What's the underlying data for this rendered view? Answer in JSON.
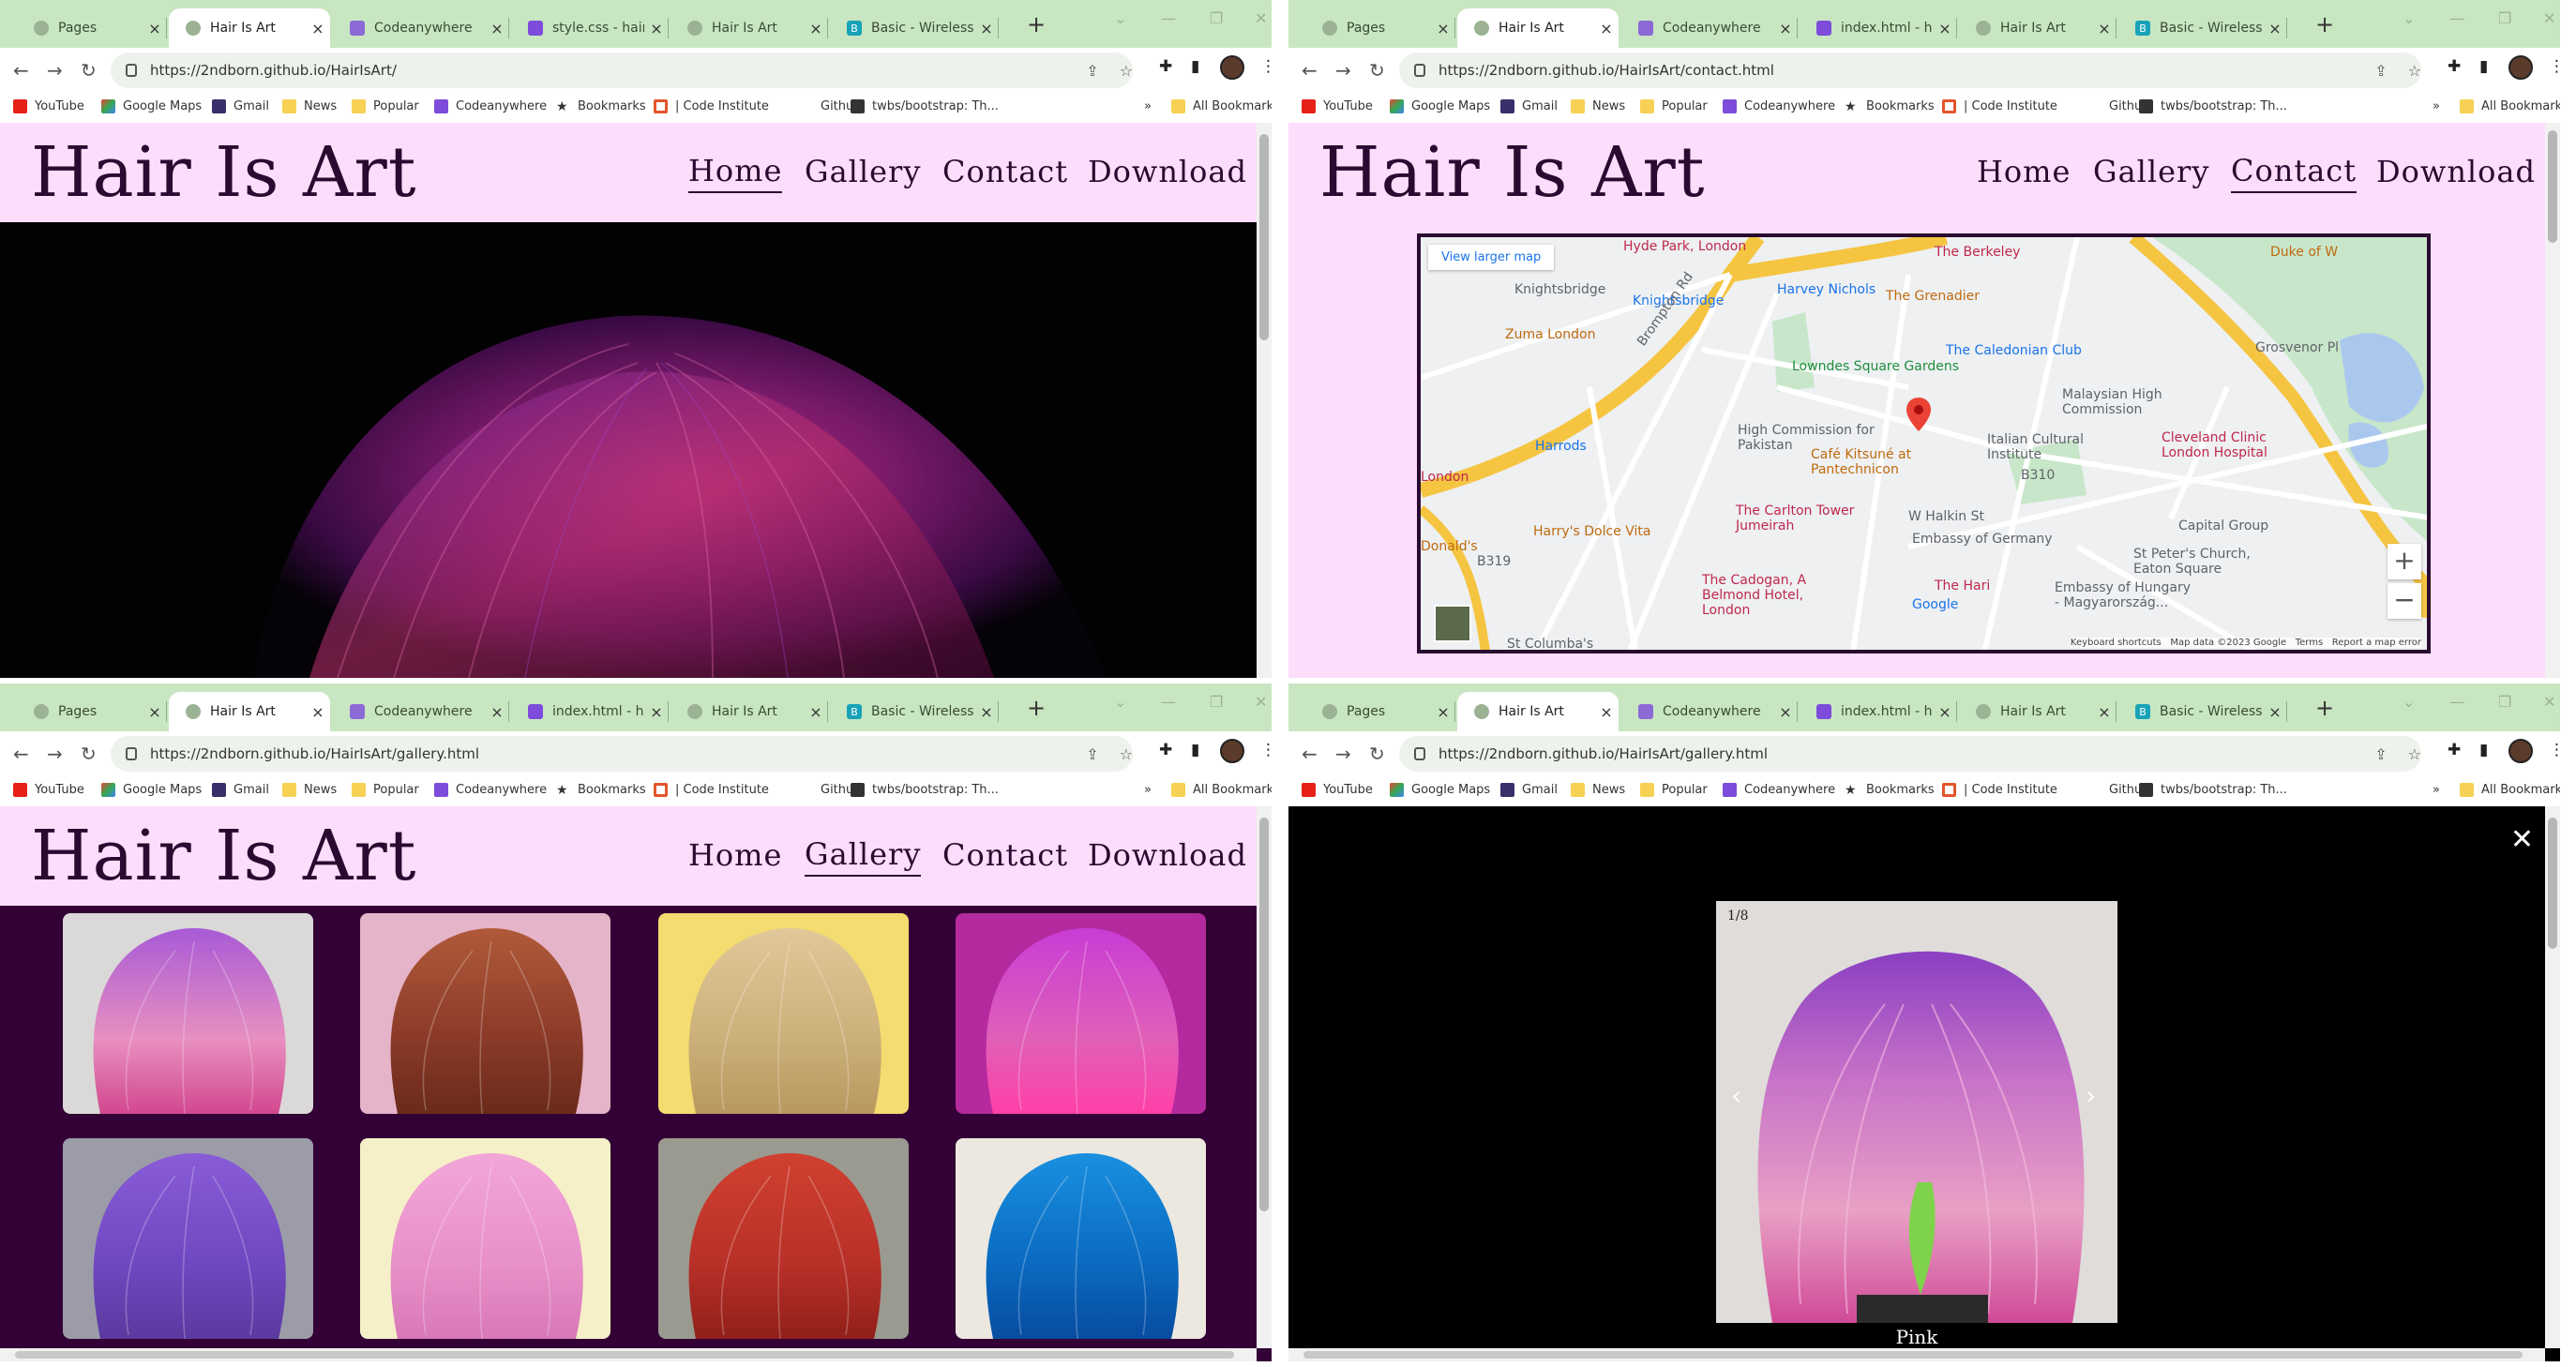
{
  "colors": {
    "tabstrip": "#c8e6c1",
    "site_header": "#fdddfc",
    "site_text": "#2a0a30",
    "gallery_bg": "#330135"
  },
  "windows": [
    {
      "tabs": [
        "Pages",
        "Hair Is Art",
        "Codeanywhere",
        "style.css - hair-is-...",
        "Hair Is Art",
        "Basic - Wireless"
      ],
      "active_tab": 1,
      "url": "https://2ndborn.github.io/HairIsArt/",
      "page": "home",
      "nav_current": "Home"
    },
    {
      "tabs": [
        "Pages",
        "Hair Is Art",
        "Codeanywhere",
        "index.html - hair-i...",
        "Hair Is Art",
        "Basic - Wireless"
      ],
      "active_tab": 1,
      "url": "https://2ndborn.github.io/HairIsArt/contact.html",
      "page": "contact",
      "nav_current": "Contact"
    },
    {
      "tabs": [
        "Pages",
        "Hair Is Art",
        "Codeanywhere",
        "index.html - hair-...",
        "Hair Is Art",
        "Basic - Wireless"
      ],
      "active_tab": 1,
      "url": "https://2ndborn.github.io/HairIsArt/gallery.html",
      "page": "gallery",
      "nav_current": "Gallery"
    },
    {
      "tabs": [
        "Pages",
        "Hair Is Art",
        "Codeanywhere",
        "index.html - hair-i...",
        "Hair Is Art",
        "Basic - Wireless"
      ],
      "active_tab": 1,
      "url": "https://2ndborn.github.io/HairIsArt/gallery.html",
      "page": "lightbox"
    }
  ],
  "bookmarks": [
    "YouTube",
    "Google Maps",
    "Gmail",
    "News",
    "Popular",
    "Codeanywhere",
    "Bookmarks",
    "| Code Institute",
    "Github",
    "twbs/bootstrap: Th...",
    "All Bookmarks"
  ],
  "site": {
    "logo": "Hair Is Art",
    "nav": [
      "Home",
      "Gallery",
      "Contact",
      "Download"
    ]
  },
  "map": {
    "view_larger": "View larger map",
    "labels": [
      "Hyde Park, London",
      "The Berkeley",
      "Duke of W",
      "Knightsbridge",
      "Knightsbridge",
      "Harvey Nichols",
      "The Grenadier",
      "Zuma London",
      "Brompton Rd",
      "Lowndes Square Gardens",
      "The Caledonian Club",
      "Grosvenor Pl",
      "Harrods",
      "High Commission for Pakistan",
      "Malaysian High Commission",
      "Italian Cultural Institute",
      "Cleveland Clinic London Hospital",
      "London",
      "Café Kitsuné at Pantechnicon",
      "Harry's Dolce Vita",
      "The Carlton Tower Jumeirah",
      "W Halkin St",
      "Embassy of Germany",
      "Capital Group",
      "Donald's",
      "St Peter's Church, Eaton Square",
      "The Cadogan, A Belmond Hotel, London",
      "The Hari",
      "Embassy of Hungary - Magyarország...",
      "St Columba's",
      "B319",
      "B310",
      "Google"
    ],
    "footer": [
      "Keyboard shortcuts",
      "Map data ©2023 Google",
      "Terms",
      "Report a map error"
    ]
  },
  "gallery": {
    "thumbs": [
      "purple-pink-green bob",
      "copper curls",
      "blonde bob",
      "magenta long hair",
      "violet bob",
      "pink curls",
      "red curls",
      "blue bob"
    ]
  },
  "lightbox": {
    "counter": "1/8",
    "caption": "Pink",
    "close": "✕",
    "prev": "‹",
    "next": "›"
  }
}
